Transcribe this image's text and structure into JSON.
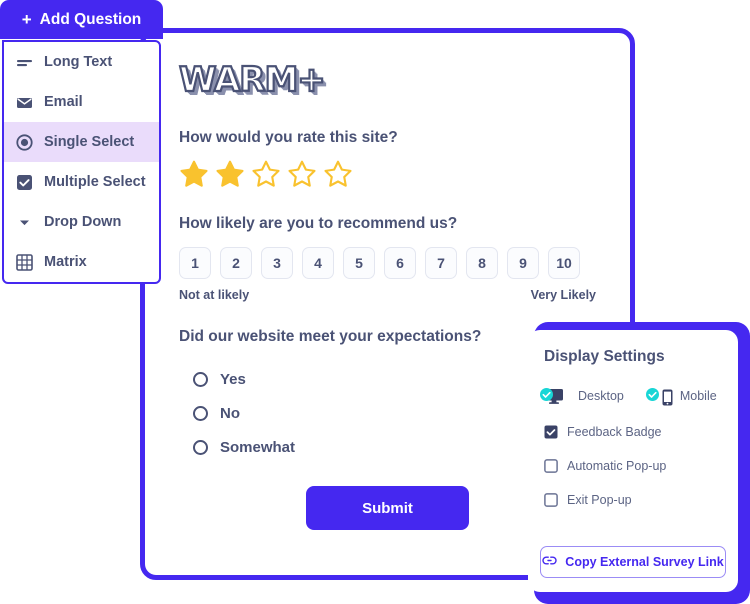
{
  "add_question": {
    "label": "Add Question",
    "plus_icon": "plus-icon"
  },
  "question_type_menu": {
    "items": [
      {
        "label": "Long Text",
        "icon": "long-text-icon",
        "active": false
      },
      {
        "label": "Email",
        "icon": "envelope-icon",
        "active": false
      },
      {
        "label": "Single Select",
        "icon": "radio-filled-icon",
        "active": true
      },
      {
        "label": "Multiple Select",
        "icon": "checkbox-checked-icon",
        "active": false
      },
      {
        "label": "Drop Down",
        "icon": "chevron-down-icon",
        "active": false
      },
      {
        "label": "Matrix",
        "icon": "grid-icon",
        "active": false
      }
    ]
  },
  "survey": {
    "logo_text": "WARM+",
    "rating_question": "How would you rate this site?",
    "stars": {
      "total": 5,
      "filled": 2,
      "color": "#f9c22e"
    },
    "nps_question": "How likely are you to recommend us?",
    "nps_values": [
      "1",
      "2",
      "3",
      "4",
      "5",
      "6",
      "7",
      "8",
      "9",
      "10"
    ],
    "nps_low_label": "Not at likely",
    "nps_high_label": "Very Likely",
    "expectations_question": "Did our website meet your expectations?",
    "expectations_options": [
      "Yes",
      "No",
      "Somewhat"
    ],
    "submit_label": "Submit"
  },
  "display_settings": {
    "title": "Display Settings",
    "devices": [
      {
        "label": "Desktop",
        "icon": "desktop-icon",
        "enabled": true
      },
      {
        "label": "Mobile",
        "icon": "mobile-icon",
        "enabled": true
      }
    ],
    "checkboxes": [
      {
        "label": "Feedback Badge",
        "checked": true
      },
      {
        "label": "Automatic Pop-up",
        "checked": false
      },
      {
        "label": "Exit Pop-up",
        "checked": false
      }
    ],
    "copy_link_label": "Copy External Survey Link",
    "copy_link_icon": "link-icon"
  },
  "colors": {
    "accent_purple": "#4528f0",
    "text_navy": "#4a5275",
    "star_yellow": "#f9c22e",
    "check_cyan": "#18d6d6",
    "menu_active_bg": "#eadcfb"
  }
}
